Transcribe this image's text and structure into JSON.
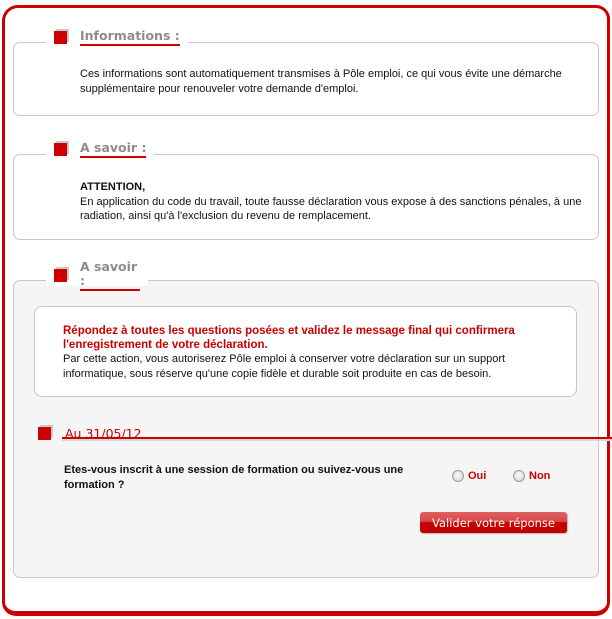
{
  "colors": {
    "accent": "#cc0000",
    "legend_text": "#8c8c8c",
    "panel_grey": "#f5f5f5",
    "border_grey": "#c8c8c8"
  },
  "sections": [
    {
      "title": "Informations :",
      "icon": "red-square-bullet",
      "text": "Ces informations sont automatiquement transmises à Pôle emploi, ce qui vous évite une démarche supplémentaire pour renouveler votre demande d'emploi."
    },
    {
      "title": "A savoir :",
      "icon": "red-square-bullet",
      "heading": "ATTENTION,",
      "text": "En application du code du travail, toute fausse déclaration vous expose à des sanctions pénales, à une radiation, ainsi qu'à l'exclusion du revenu de remplacement."
    },
    {
      "title": "A savoir :",
      "icon": "red-square-bullet",
      "notice_strong": "Répondez à toutes les questions posées et validez le message final qui confirmera l'enregistrement de votre déclaration.",
      "notice_text": "Par cette action, vous autoriserez Pôle emploi à conserver votre déclaration sur un support informatique, sous réserve qu'une copie fidèle et durable soit produite en cas de besoin."
    }
  ],
  "form": {
    "date_title": "Au 31/05/12",
    "question": "Etes-vous inscrit à une session de formation ou suivez-vous une formation ?",
    "options": [
      {
        "label": "Oui",
        "selected": false
      },
      {
        "label": "Non",
        "selected": false
      }
    ],
    "submit_label": "Valider votre réponse"
  }
}
